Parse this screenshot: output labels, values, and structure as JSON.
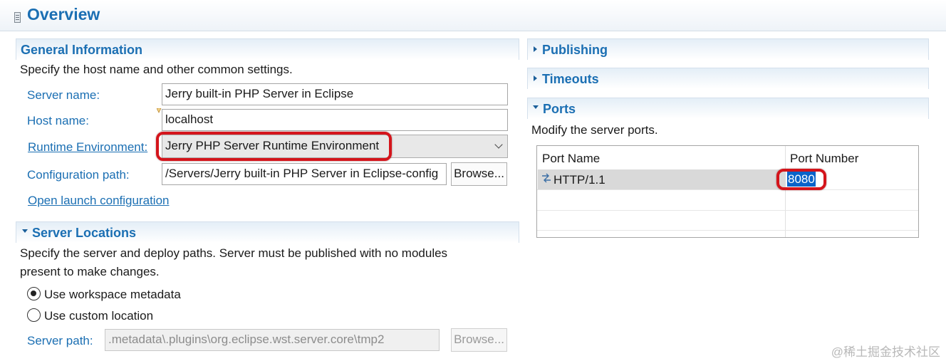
{
  "header": {
    "title": "Overview"
  },
  "general": {
    "title": "General Information",
    "description": "Specify the host name and other common settings.",
    "server_name_label": "Server name:",
    "server_name_value": "Jerry built-in PHP Server in Eclipse",
    "host_name_label": "Host name:",
    "host_name_value": "localhost",
    "runtime_label": "Runtime Environment:",
    "runtime_value": "Jerry PHP Server Runtime Environment",
    "config_path_label": "Configuration path:",
    "config_path_value": "/Servers/Jerry built-in PHP Server in Eclipse-config",
    "browse_label": "Browse...",
    "open_launch_label": "Open launch configuration"
  },
  "locations": {
    "title": "Server Locations",
    "description_line1": "Specify the server and deploy paths. Server must be published with no modules",
    "description_line2": "present to make changes.",
    "use_workspace_label": "Use workspace metadata",
    "use_custom_label": "Use custom location",
    "selected_option": "Use workspace metadata",
    "server_path_label": "Server path:",
    "server_path_value": ".metadata\\.plugins\\org.eclipse.wst.server.core\\tmp2",
    "browse_label": "Browse..."
  },
  "publishing": {
    "title": "Publishing"
  },
  "timeouts": {
    "title": "Timeouts"
  },
  "ports": {
    "title": "Ports",
    "description": "Modify the server ports.",
    "columns": [
      "Port Name",
      "Port Number"
    ],
    "rows": [
      {
        "name": "HTTP/1.1",
        "number": "8080"
      }
    ]
  },
  "watermark": "@稀土掘金技术社区",
  "colors": {
    "accent": "#1b6fb3",
    "highlight_box": "#d4141b",
    "selection": "#0a63c9"
  },
  "icons": [
    "page-icon",
    "chevron-down-icon",
    "twisty-expanded-icon",
    "twisty-collapsed-icon",
    "protocol-icon"
  ]
}
